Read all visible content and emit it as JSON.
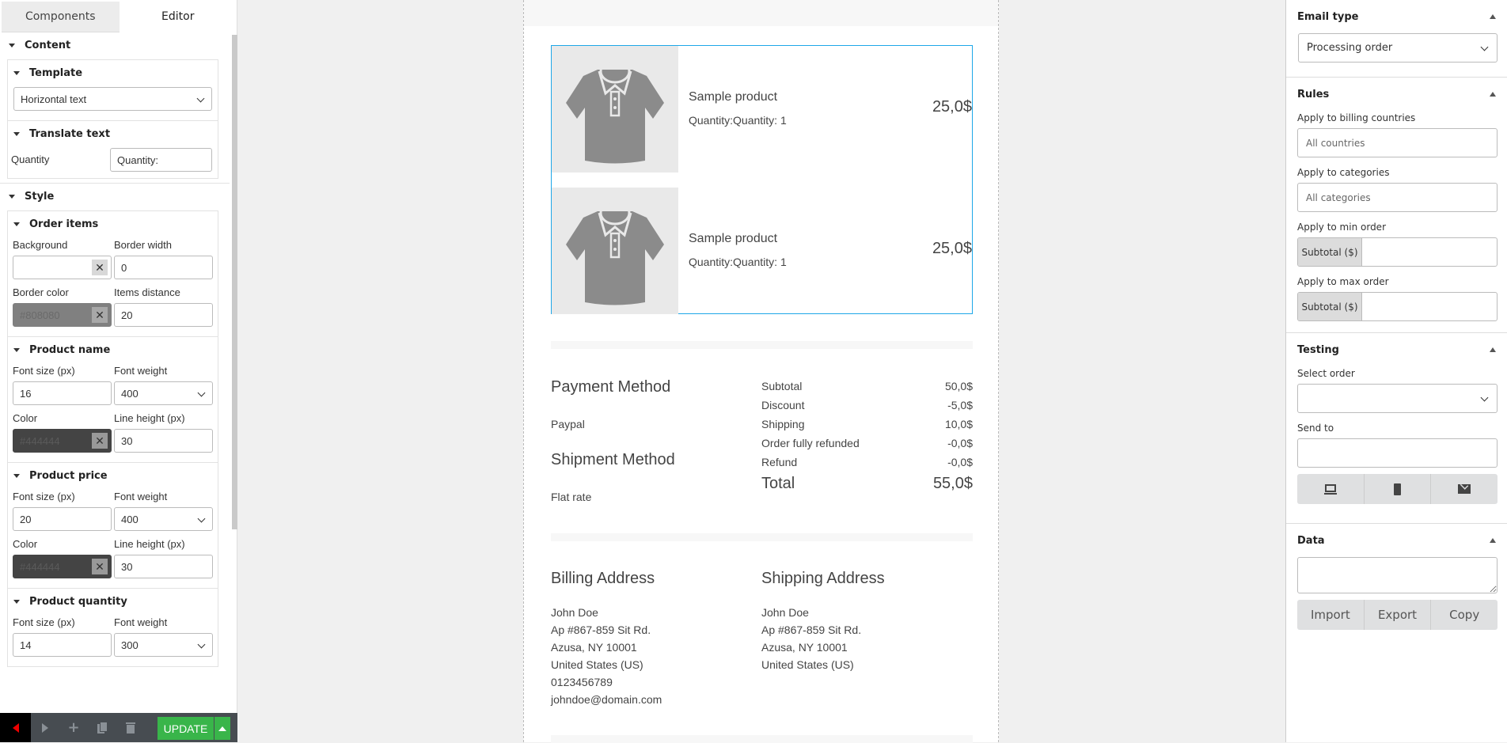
{
  "left_panel": {
    "tabs": [
      {
        "label": "Components",
        "active": false
      },
      {
        "label": "Editor",
        "active": true
      }
    ],
    "content": {
      "title": "Content",
      "template": {
        "title": "Template",
        "value": "Horizontal text"
      },
      "translate": {
        "title": "Translate text",
        "quantity_label": "Quantity",
        "quantity_value": "Quantity:"
      }
    },
    "style": {
      "title": "Style",
      "order_items": {
        "title": "Order items",
        "background_label": "Background",
        "background_value": "",
        "border_width_label": "Border width",
        "border_width_value": "0",
        "border_color_label": "Border color",
        "border_color_value": "#808080",
        "items_distance_label": "Items distance",
        "items_distance_value": "20"
      },
      "product_name": {
        "title": "Product name",
        "font_size_label": "Font size (px)",
        "font_size_value": "16",
        "font_weight_label": "Font weight",
        "font_weight_value": "400",
        "color_label": "Color",
        "color_value": "#444444",
        "line_height_label": "Line height (px)",
        "line_height_value": "30"
      },
      "product_price": {
        "title": "Product price",
        "font_size_label": "Font size (px)",
        "font_size_value": "20",
        "font_weight_label": "Font weight",
        "font_weight_value": "400",
        "color_label": "Color",
        "color_value": "#444444",
        "line_height_label": "Line height (px)",
        "line_height_value": "30"
      },
      "product_quantity": {
        "title": "Product quantity",
        "font_size_label": "Font size (px)",
        "font_size_value": "14",
        "font_weight_label": "Font weight",
        "font_weight_value": "300"
      }
    },
    "toolbar": {
      "icons": [
        "back-arrow-icon",
        "forward-arrow-icon",
        "plus-icon",
        "copy-icon",
        "trash-icon"
      ],
      "update_label": "UPDATE"
    }
  },
  "email": {
    "items": [
      {
        "name": "Sample product",
        "quantity": "Quantity:Quantity: 1",
        "price": "25,0$"
      },
      {
        "name": "Sample product",
        "quantity": "Quantity:Quantity: 1",
        "price": "25,0$"
      }
    ],
    "payment_method_title": "Payment Method",
    "payment_method_value": "Paypal",
    "shipment_method_title": "Shipment Method",
    "shipment_method_value": "Flat rate",
    "totals": [
      {
        "label": "Subtotal",
        "value": "50,0$"
      },
      {
        "label": "Discount",
        "value": "-5,0$"
      },
      {
        "label": "Shipping",
        "value": "10,0$"
      },
      {
        "label": "Order fully refunded",
        "value": "-0,0$"
      },
      {
        "label": "Refund",
        "value": "-0,0$"
      }
    ],
    "total": {
      "label": "Total",
      "value": "55,0$"
    },
    "billing": {
      "title": "Billing Address",
      "lines": [
        "John Doe",
        "Ap #867-859 Sit Rd.",
        "Azusa, NY 10001",
        "United States (US)",
        "0123456789",
        "johndoe@domain.com"
      ]
    },
    "shipping": {
      "title": "Shipping Address",
      "lines": [
        "John Doe",
        "Ap #867-859 Sit Rd.",
        "Azusa, NY 10001",
        "United States (US)"
      ]
    }
  },
  "right_panel": {
    "email_type": {
      "title": "Email type",
      "value": "Processing order"
    },
    "rules": {
      "title": "Rules",
      "billing_countries_label": "Apply to billing countries",
      "billing_countries_placeholder": "All countries",
      "categories_label": "Apply to categories",
      "categories_placeholder": "All categories",
      "min_order_label": "Apply to min order",
      "min_order_addon": "Subtotal ($)",
      "max_order_label": "Apply to max order",
      "max_order_addon": "Subtotal ($)"
    },
    "testing": {
      "title": "Testing",
      "select_order_label": "Select order",
      "select_order_value": "",
      "send_to_label": "Send to",
      "send_to_value": "",
      "buttons": [
        "desktop-preview-icon",
        "mobile-preview-icon",
        "send-email-icon"
      ]
    },
    "data": {
      "title": "Data",
      "value": "",
      "buttons": [
        "Import",
        "Export",
        "Copy"
      ]
    }
  },
  "colors": {
    "selection_border": "#1ea7e8",
    "update_button": "#39b54a",
    "toolbar_bg": "#474c51"
  }
}
